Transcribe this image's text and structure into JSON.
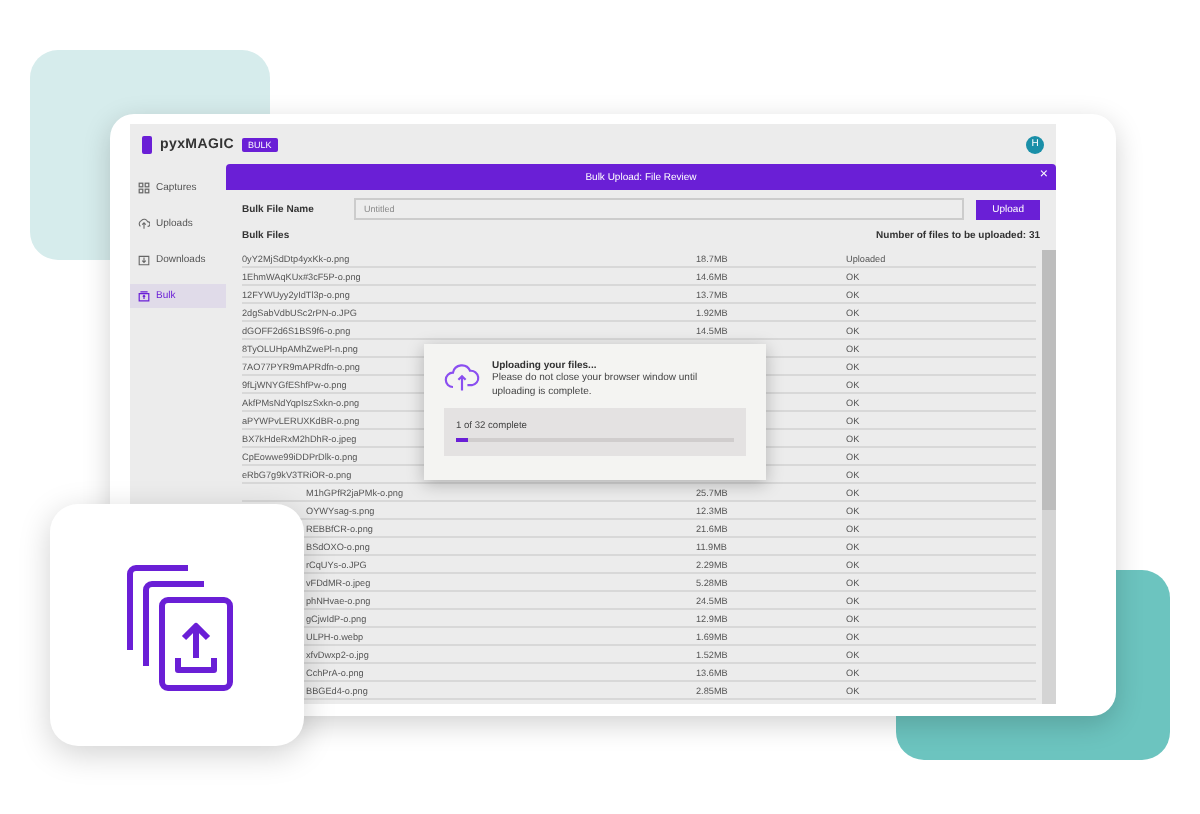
{
  "header": {
    "logo": "pyxMAGIC",
    "badge": "BULK",
    "avatar": "H"
  },
  "sidebar": {
    "items": [
      {
        "label": "Captures",
        "kind": "grid",
        "selected": false
      },
      {
        "label": "Uploads",
        "kind": "upload",
        "selected": false
      },
      {
        "label": "Downloads",
        "kind": "download",
        "selected": false
      },
      {
        "label": "Bulk",
        "kind": "stack",
        "selected": true
      }
    ]
  },
  "panel": {
    "title": "Bulk Upload: File Review",
    "close": "×",
    "file_name_label": "Bulk File Name",
    "file_name_placeholder": "Untitled",
    "upload_button": "Upload",
    "files_label": "Bulk Files",
    "count_label": "Number of files to be uploaded: 31"
  },
  "files": [
    {
      "name": "0yY2MjSdDtp4yxKk-o.png",
      "size": "18.7MB",
      "status": "Uploaded",
      "kind": "full"
    },
    {
      "name": "1EhmWAqKUx#3cF5P-o.png",
      "size": "14.6MB",
      "status": "OK",
      "kind": "full"
    },
    {
      "name": "12FYWUyy2yIdTl3p-o.png",
      "size": "13.7MB",
      "status": "OK",
      "kind": "full"
    },
    {
      "name": "2dgSabVdbUSc2rPN-o.JPG",
      "size": "1.92MB",
      "status": "OK",
      "kind": "full"
    },
    {
      "name": "dGOFF2d6S1BS9f6-o.png",
      "size": "14.5MB",
      "status": "OK",
      "kind": "full"
    },
    {
      "name": "8TyOLUHpAMhZwePl-n.png",
      "status": "OK",
      "kind": "full"
    },
    {
      "name": "7AO77PYR9mAPRdfn-o.png",
      "status": "OK",
      "kind": "full"
    },
    {
      "name": "9fLjWNYGfEShfPw-o.png",
      "status": "OK",
      "kind": "full"
    },
    {
      "name": "AkfPMsNdYqpIszSxkn-o.png",
      "status": "OK",
      "kind": "full"
    },
    {
      "name": "aPYWPvLERUXKdBR-o.png",
      "status": "OK",
      "kind": "full"
    },
    {
      "name": "BX7kHdeRxM2hDhR-o.jpeg",
      "status": "OK",
      "kind": "full"
    },
    {
      "name": "CpEowwe99iDDPrDlk-o.png",
      "status": "OK",
      "kind": "full"
    },
    {
      "name": "eRbG7g9kV3TRiOR-o.png",
      "status": "OK",
      "kind": "full"
    },
    {
      "name": "M1hGPfR2jaPMk-o.png",
      "size": "25.7MB",
      "status": "OK",
      "kind": "partial"
    },
    {
      "name": "OYWYsag-s.png",
      "size": "12.3MB",
      "status": "OK",
      "kind": "partial"
    },
    {
      "name": "REBBfCR-o.png",
      "size": "21.6MB",
      "status": "OK",
      "kind": "partial"
    },
    {
      "name": "BSdOXO-o.png",
      "size": "11.9MB",
      "status": "OK",
      "kind": "partial"
    },
    {
      "name": "rCqUYs-o.JPG",
      "size": "2.29MB",
      "status": "OK",
      "kind": "partial"
    },
    {
      "name": "vFDdMR-o.jpeg",
      "size": "5.28MB",
      "status": "OK",
      "kind": "partial"
    },
    {
      "name": "phNHvae-o.png",
      "size": "24.5MB",
      "status": "OK",
      "kind": "partial"
    },
    {
      "name": "gCjwIdP-o.png",
      "size": "12.9MB",
      "status": "OK",
      "kind": "partial"
    },
    {
      "name": "ULPH-o.webp",
      "size": "1.69MB",
      "status": "OK",
      "kind": "partial"
    },
    {
      "name": "xfvDwxp2-o.jpg",
      "size": "1.52MB",
      "status": "OK",
      "kind": "partial"
    },
    {
      "name": "CchPrA-o.png",
      "size": "13.6MB",
      "status": "OK",
      "kind": "partial"
    },
    {
      "name": "BBGEd4-o.png",
      "size": "2.85MB",
      "status": "OK",
      "kind": "partial"
    }
  ],
  "dialog": {
    "title": "Uploading your files...",
    "message": "Please do not close your browser window until uploading is complete.",
    "progress_text": "1 of 32 complete",
    "level": 0.04
  }
}
